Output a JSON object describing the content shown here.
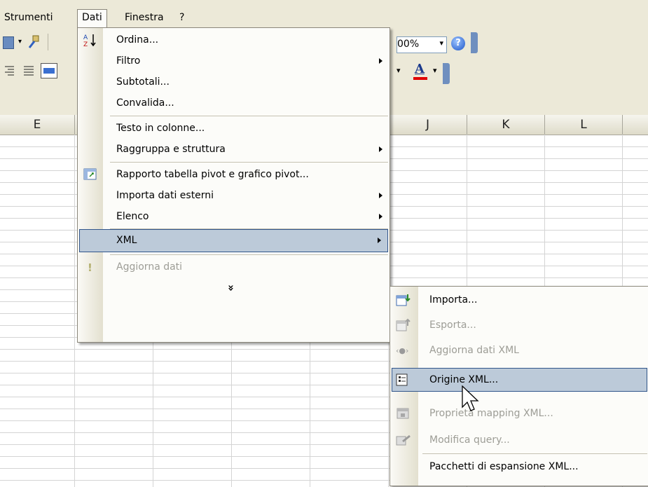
{
  "menubar": {
    "items": [
      {
        "label": "Strumenti",
        "accel": "S"
      },
      {
        "label": "Dati",
        "accel": "D"
      },
      {
        "label": "Finestra",
        "accel": "n"
      },
      {
        "label": "?",
        "accel": "?"
      }
    ]
  },
  "toolbar": {
    "zoom": "00%",
    "font_color_letter": "A"
  },
  "columns": [
    "E",
    "J",
    "K",
    "L"
  ],
  "dati_menu": {
    "items": [
      {
        "label": "Ordina...",
        "icon": "sort-ascending-icon"
      },
      {
        "label": "Filtro",
        "submenu": true
      },
      {
        "label": "Subtotali..."
      },
      {
        "label": "Convalida..."
      },
      {
        "label": "Testo in colonne..."
      },
      {
        "label": "Raggruppa e struttura",
        "submenu": true
      },
      {
        "label": "Rapporto tabella pivot e grafico pivot...",
        "icon": "pivot-table-icon"
      },
      {
        "label": "Importa dati esterni",
        "submenu": true
      },
      {
        "label": "Elenco",
        "submenu": true
      },
      {
        "label": "XML",
        "submenu": true,
        "highlighted": true
      },
      {
        "label": "Aggiorna dati",
        "disabled": true,
        "icon": "refresh-exclamation-icon"
      }
    ],
    "expand_glyph": "»"
  },
  "xml_menu": {
    "items": [
      {
        "label": "Importa...",
        "icon": "xml-import-icon"
      },
      {
        "label": "Esporta...",
        "disabled": true,
        "icon": "xml-export-icon"
      },
      {
        "label": "Aggiorna dati XML",
        "disabled": true,
        "icon": "xml-refresh-icon"
      },
      {
        "label": "Origine XML...",
        "highlighted": true,
        "icon": "xml-source-icon"
      },
      {
        "label": "Proprietà mapping XML...",
        "disabled": true,
        "icon": "xml-map-properties-icon"
      },
      {
        "label": "Modifica query...",
        "disabled": true,
        "icon": "edit-query-icon"
      },
      {
        "label": "Pacchetti di espansione XML..."
      }
    ]
  }
}
